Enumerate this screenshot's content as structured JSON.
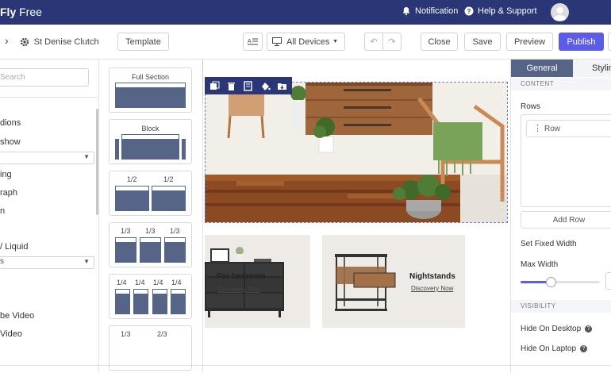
{
  "app": {
    "brand_main": "Fly",
    "brand_sub": " Free",
    "notification_label": "Notification",
    "help_label": "Help & Support"
  },
  "toolbar": {
    "back_glyph": "›",
    "page_name": "St Denise Clutch",
    "template_label": "Template",
    "device_label": "All Devices",
    "close_label": "Close",
    "save_label": "Save",
    "preview_label": "Preview",
    "publish_label": "Publish"
  },
  "left_panel": {
    "search_placeholder": "Search",
    "items": [
      "dions",
      "show",
      "ing",
      "raph",
      "n",
      "/ Liquid",
      "",
      "be Video",
      "Video"
    ],
    "select_values": [
      "",
      "s"
    ]
  },
  "layouts": {
    "full_section": "Full Section",
    "block": "Block",
    "half": "1/2",
    "third": "1/3",
    "quarter": "1/4",
    "two_thirds": "2/3"
  },
  "canvas": {
    "card1_title": "For bedroom",
    "card1_link": "Discovery Now",
    "card2_title": "Nightstands",
    "card2_link": "Discovery Now"
  },
  "right_panel": {
    "tab_general": "General",
    "tab_styling": "Styling",
    "section_content": "CONTENT",
    "rows_label": "Rows",
    "row_item": "Row",
    "add_row": "Add Row",
    "fixed_width": "Set Fixed Width",
    "max_width": "Max Width",
    "max_width_slider_fraction": 0.38,
    "section_visibility": "VISIBILITY",
    "hide_desktop": "Hide On Desktop",
    "hide_laptop": "Hide On Laptop"
  },
  "colors": {
    "topbar": "#2a3676",
    "accent": "#5b5ce8",
    "layout_block": "#566487"
  }
}
